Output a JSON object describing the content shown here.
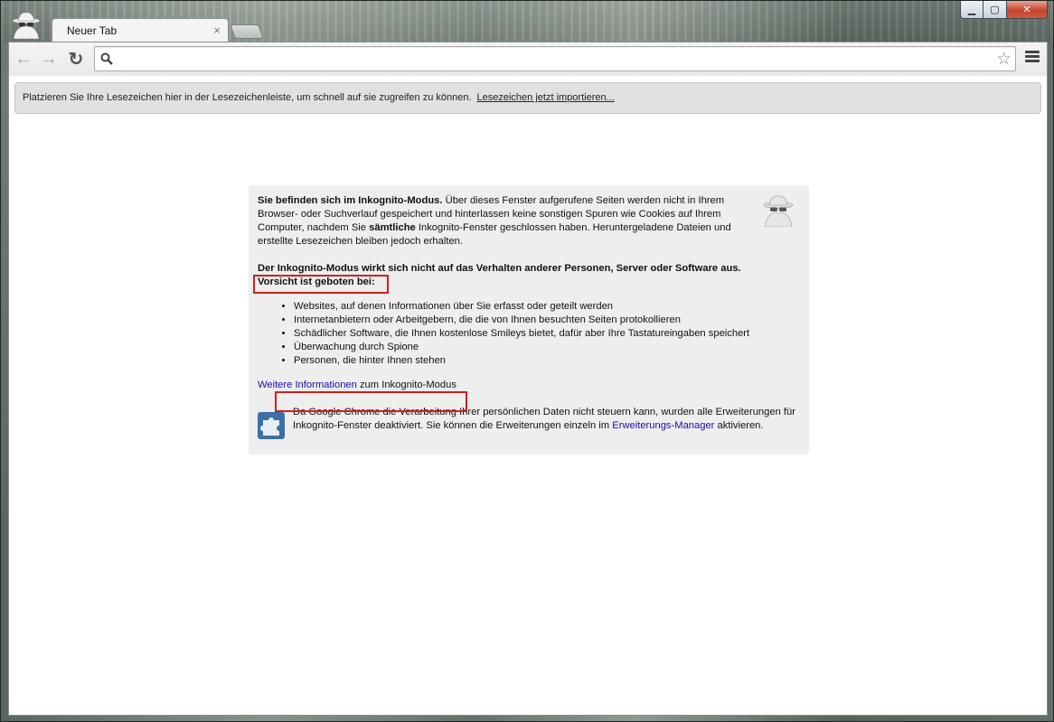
{
  "window": {
    "tab_title": "Neuer Tab",
    "tab_close": "×",
    "minimize": "▁",
    "maximize": "▢",
    "close": "✕"
  },
  "toolbar": {
    "back_icon": "←",
    "forward_icon": "→",
    "reload_icon": "↻",
    "address_value": "",
    "star_icon": "☆"
  },
  "bookmark_bar": {
    "text": "Platzieren Sie Ihre Lesezeichen hier in der Lesezeichenleiste, um schnell auf sie zugreifen zu können.",
    "import_link": "Lesezeichen jetzt importieren..."
  },
  "incognito": {
    "intro_bold": "Sie befinden sich im Inkognito-Modus.",
    "intro_text_1": " Über dieses Fenster aufgerufene Seiten werden nicht in Ihrem Browser- oder Suchverlauf gespeichert und hinterlassen keine sonstigen Spuren wie Cookies auf Ihrem Computer, nachdem Sie ",
    "intro_bold_2": "sämtliche",
    "intro_text_2": " Inkognito-Fenster geschlossen haben. Heruntergeladene Dateien und erstellte Lesezeichen bleiben jedoch erhalten.",
    "warning": "Der Inkognito-Modus wirkt sich nicht auf das Verhalten anderer Personen, Server oder Software aus.",
    "caution": "Vorsicht ist geboten bei:",
    "list": [
      "Websites, auf denen Informationen über Sie erfasst oder geteilt werden",
      "Internetanbietern oder Arbeitgebern, die die von Ihnen besuchten Seiten protokollieren",
      "Schädlicher Software, die Ihnen kostenlose Smileys bietet, dafür aber Ihre Tastatureingaben speichert",
      "Überwachung durch Spione",
      "Personen, die hinter Ihnen stehen"
    ],
    "more_link": "Weitere Informationen",
    "more_text": " zum Inkognito-Modus",
    "ext_text_1": "Da Google Chrome die Verarbeitung Ihrer persönlichen Daten nicht steuern kann, wurden alle Erweiterungen für Inkognito-Fenster deaktiviert. Sie können die Erweiterungen einzeln im ",
    "ext_link": "Erweiterungs-Manager",
    "ext_text_2": " aktivieren."
  },
  "colors": {
    "highlight_box": "#d21f1f",
    "link": "#1a0dab",
    "panel_bg": "#eeeeee"
  }
}
